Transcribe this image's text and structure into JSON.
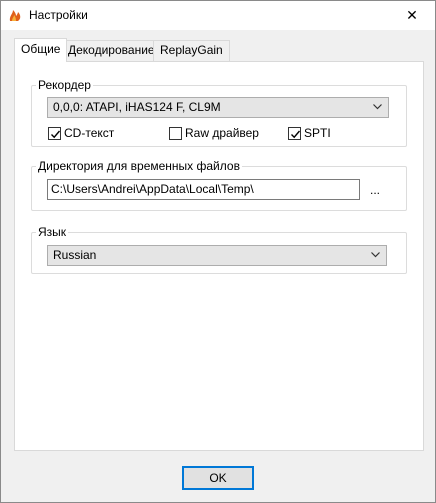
{
  "window": {
    "title": "Настройки",
    "close_glyph": "✕",
    "icon": "flame-icon"
  },
  "tabs": [
    {
      "label": "Общие",
      "active": true
    },
    {
      "label": "Декодирование",
      "active": false
    },
    {
      "label": "ReplayGain",
      "active": false
    }
  ],
  "recorder": {
    "group_title": "Рекордер",
    "device": "0,0,0: ATAPI, iHAS124  F, CL9M",
    "options": [
      {
        "label": "CD-текст",
        "checked": true
      },
      {
        "label": "Raw драйвер",
        "checked": false
      },
      {
        "label": "SPTI",
        "checked": true
      }
    ]
  },
  "temp_dir": {
    "group_title": "Директория для временных файлов",
    "path": "C:\\Users\\Andrei\\AppData\\Local\\Temp\\",
    "browse_label": "..."
  },
  "language": {
    "group_title": "Язык",
    "selected": "Russian"
  },
  "footer": {
    "ok_label": "OK"
  },
  "colors": {
    "accent": "#0078d7",
    "combo_bg": "#e5e5e5"
  }
}
